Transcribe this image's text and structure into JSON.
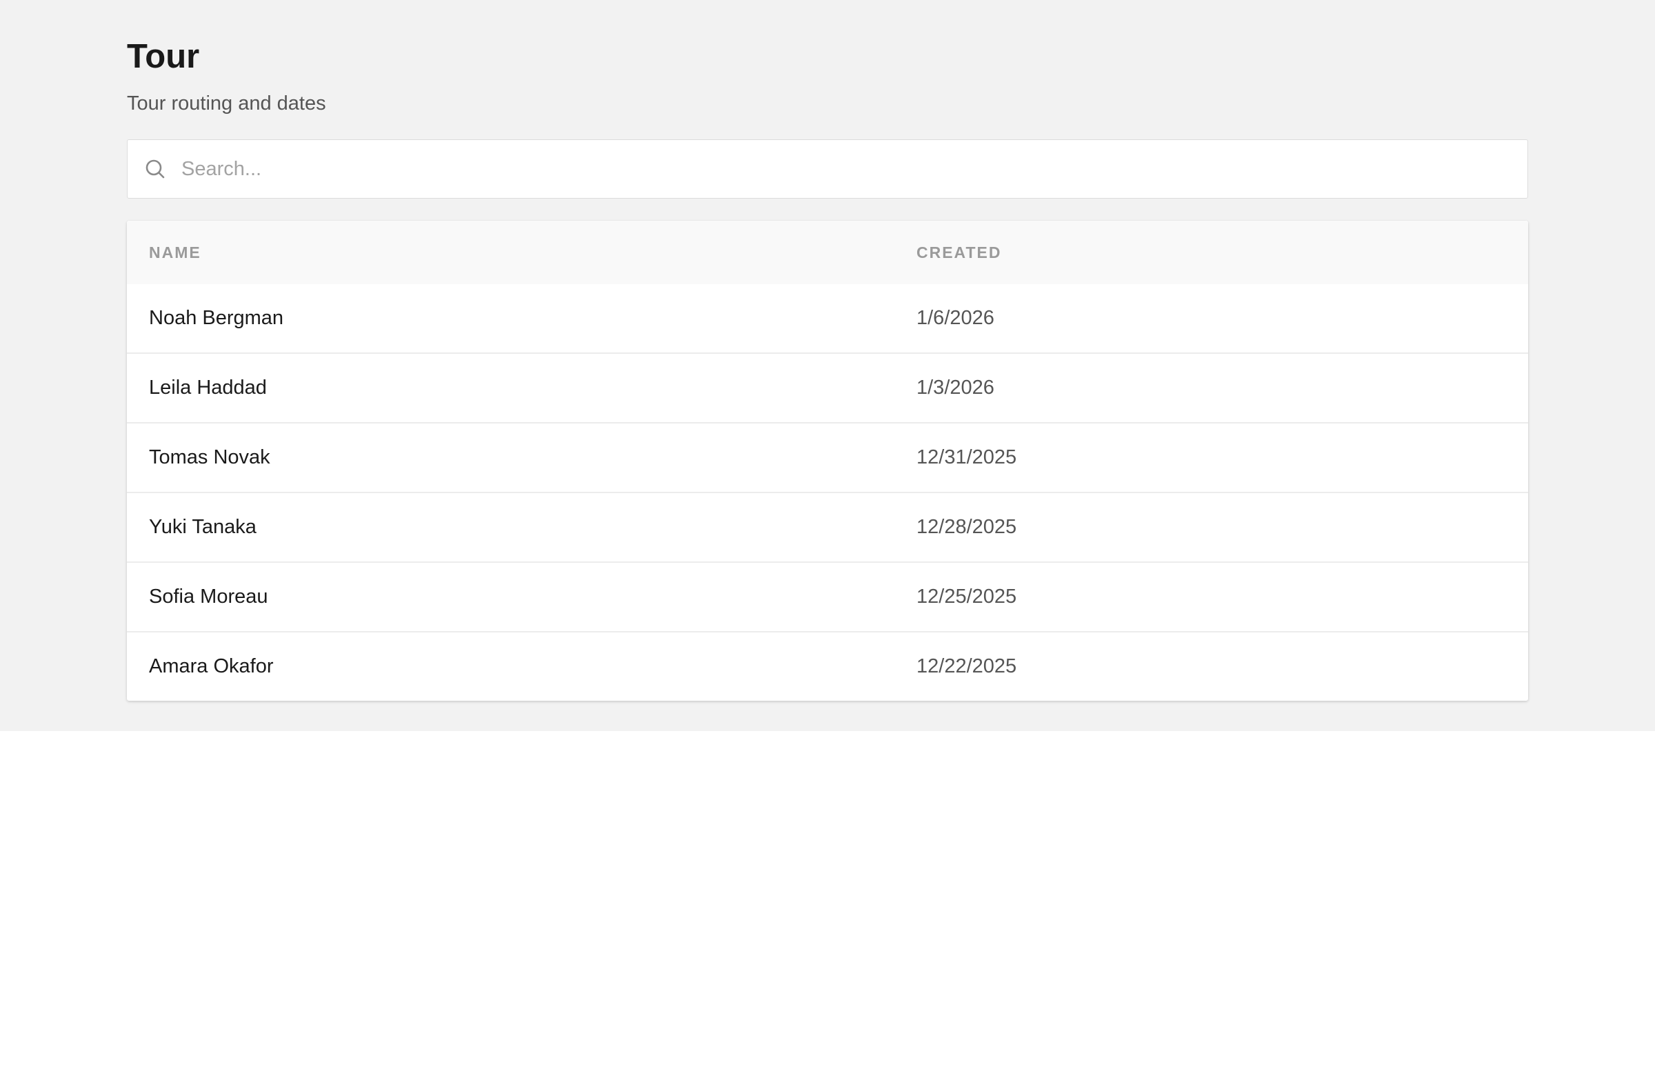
{
  "header": {
    "title": "Tour",
    "subtitle": "Tour routing and dates"
  },
  "search": {
    "placeholder": "Search...",
    "value": "",
    "icon": "search-icon"
  },
  "table": {
    "columns": [
      "NAME",
      "CREATED"
    ],
    "rows": [
      {
        "name": "Noah Bergman",
        "created": "1/6/2026"
      },
      {
        "name": "Leila Haddad",
        "created": "1/3/2026"
      },
      {
        "name": "Tomas Novak",
        "created": "12/31/2025"
      },
      {
        "name": "Yuki Tanaka",
        "created": "12/28/2025"
      },
      {
        "name": "Sofia Moreau",
        "created": "12/25/2025"
      },
      {
        "name": "Amara Okafor",
        "created": "12/22/2025"
      }
    ]
  },
  "colors": {
    "background": "#f2f2f2",
    "card": "#ffffff",
    "header_row": "#f9f9f9",
    "title_text": "#1a1a1a",
    "muted_text": "#555555",
    "column_header_text": "#9a9a9a"
  }
}
